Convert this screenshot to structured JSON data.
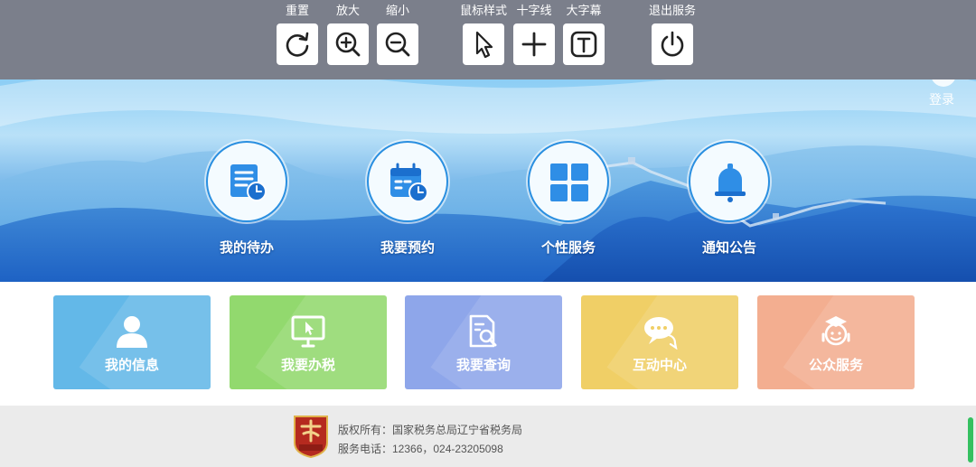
{
  "toolbar": {
    "reset": {
      "label": "重置",
      "icon": "reset-icon"
    },
    "zoom_in": {
      "label": "放大",
      "icon": "zoom-in-icon"
    },
    "zoom_out": {
      "label": "缩小",
      "icon": "zoom-out-icon"
    },
    "cursor_style": {
      "label": "鼠标样式",
      "icon": "cursor-icon"
    },
    "crosshair": {
      "label": "十字线",
      "icon": "crosshair-icon"
    },
    "large_text": {
      "label": "大字幕",
      "icon": "large-text-icon"
    },
    "exit": {
      "label": "退出服务",
      "icon": "power-icon"
    }
  },
  "header": {
    "login_label": "登录"
  },
  "quick_links": [
    {
      "label": "我的待办",
      "icon": "todo-list-icon"
    },
    {
      "label": "我要预约",
      "icon": "calendar-clock-icon"
    },
    {
      "label": "个性服务",
      "icon": "grid-icon"
    },
    {
      "label": "通知公告",
      "icon": "bell-icon"
    }
  ],
  "services": [
    {
      "label": "我的信息",
      "icon": "user-icon",
      "color": "#63b8e8"
    },
    {
      "label": "我要办税",
      "icon": "monitor-cursor-icon",
      "color": "#92d96e"
    },
    {
      "label": "我要查询",
      "icon": "document-search-icon",
      "color": "#8ea6ea"
    },
    {
      "label": "互动中心",
      "icon": "chat-bubble-icon",
      "color": "#f0cf66"
    },
    {
      "label": "公众服务",
      "icon": "service-agent-icon",
      "color": "#f3ae90"
    }
  ],
  "footer": {
    "copyright": "版权所有：国家税务总局辽宁省税务局",
    "phone": "服务电话：12366，024-23205098"
  },
  "colors": {
    "toolbar_bg": "#7b7f8b",
    "accent": "#2a8fe0",
    "footer_bg": "#ebebeb"
  }
}
